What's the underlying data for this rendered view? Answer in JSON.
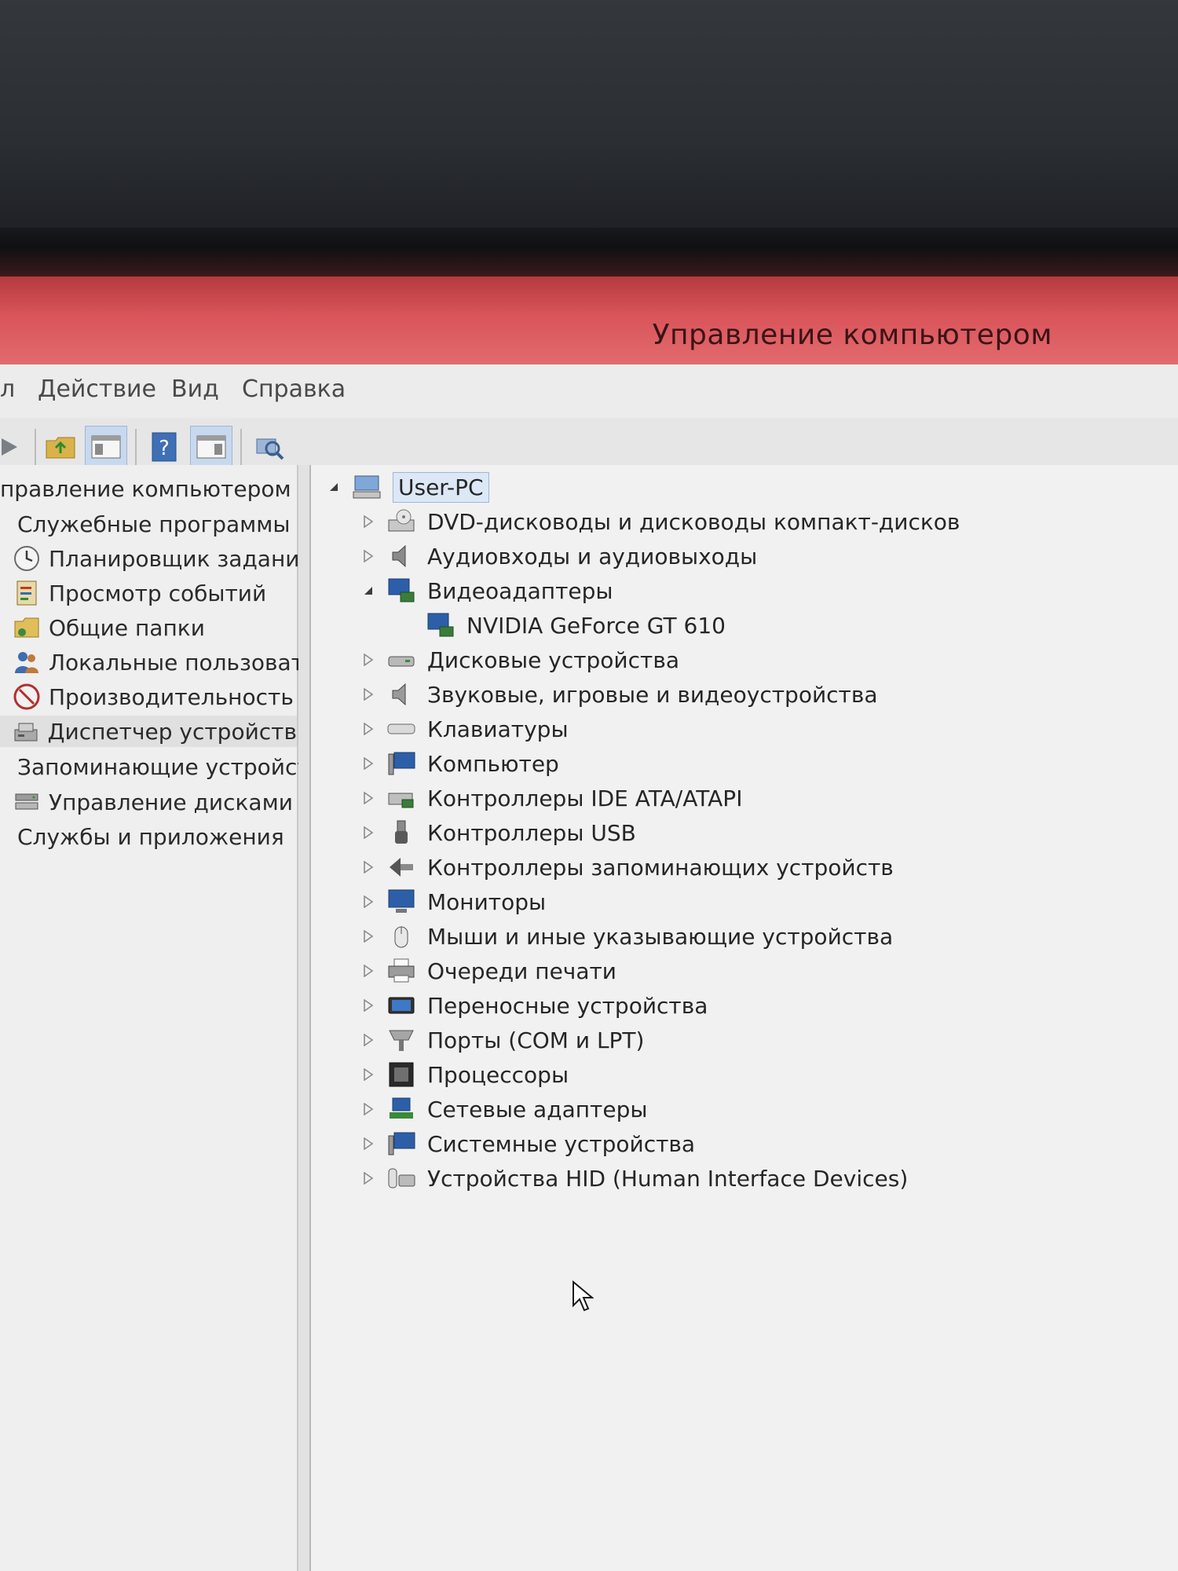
{
  "window": {
    "title": "Управление компьютером"
  },
  "menu": {
    "file_fragment": "л",
    "items": [
      "Действие",
      "Вид",
      "Справка"
    ]
  },
  "toolbar": {
    "buttons": [
      "forward-icon",
      "up-folder-icon",
      "console-tree-icon",
      "help-icon",
      "action-pane-icon",
      "scan-hardware-icon"
    ]
  },
  "nav": {
    "root": "правление компьютером (л",
    "items": [
      {
        "label": "Служебные программы",
        "level": 0,
        "icon": "tools-icon"
      },
      {
        "label": "Планировщик задани",
        "level": 1,
        "icon": "clock-icon"
      },
      {
        "label": "Просмотр событий",
        "level": 1,
        "icon": "event-viewer-icon"
      },
      {
        "label": "Общие папки",
        "level": 1,
        "icon": "shared-folders-icon"
      },
      {
        "label": "Локальные пользоват",
        "level": 1,
        "icon": "users-icon"
      },
      {
        "label": "Производительность",
        "level": 1,
        "icon": "performance-icon"
      },
      {
        "label": "Диспетчер устройств",
        "level": 1,
        "icon": "device-manager-icon",
        "selected": true
      },
      {
        "label": "Запоминающие устройст",
        "level": 0,
        "icon": "storage-icon"
      },
      {
        "label": "Управление дисками",
        "level": 1,
        "icon": "disk-management-icon"
      },
      {
        "label": "Службы и приложения",
        "level": 0,
        "icon": "services-icon"
      }
    ]
  },
  "device_tree": {
    "root": "User-PC",
    "categories": [
      {
        "label": "DVD-дисководы и дисководы компакт-дисков",
        "expanded": false,
        "icon": "dvd-drive-icon"
      },
      {
        "label": "Аудиовходы и аудиовыходы",
        "expanded": false,
        "icon": "speaker-icon"
      },
      {
        "label": "Видеоадаптеры",
        "expanded": true,
        "icon": "display-adapter-icon",
        "children": [
          "NVIDIA GeForce GT 610"
        ]
      },
      {
        "label": "Дисковые устройства",
        "expanded": false,
        "icon": "disk-drive-icon"
      },
      {
        "label": "Звуковые, игровые и видеоустройства",
        "expanded": false,
        "icon": "sound-icon"
      },
      {
        "label": "Клавиатуры",
        "expanded": false,
        "icon": "keyboard-icon"
      },
      {
        "label": "Компьютер",
        "expanded": false,
        "icon": "computer-icon"
      },
      {
        "label": "Контроллеры IDE ATA/ATAPI",
        "expanded": false,
        "icon": "ide-controller-icon"
      },
      {
        "label": "Контроллеры USB",
        "expanded": false,
        "icon": "usb-icon"
      },
      {
        "label": "Контроллеры запоминающих устройств",
        "expanded": false,
        "icon": "storage-controller-icon"
      },
      {
        "label": "Мониторы",
        "expanded": false,
        "icon": "monitor-icon"
      },
      {
        "label": "Мыши и иные указывающие устройства",
        "expanded": false,
        "icon": "mouse-icon"
      },
      {
        "label": "Очереди печати",
        "expanded": false,
        "icon": "printer-icon"
      },
      {
        "label": "Переносные устройства",
        "expanded": false,
        "icon": "portable-device-icon"
      },
      {
        "label": "Порты (COM и LPT)",
        "expanded": false,
        "icon": "port-icon"
      },
      {
        "label": "Процессоры",
        "expanded": false,
        "icon": "processor-icon"
      },
      {
        "label": "Сетевые адаптеры",
        "expanded": false,
        "icon": "network-adapter-icon"
      },
      {
        "label": "Системные устройства",
        "expanded": false,
        "icon": "system-device-icon"
      },
      {
        "label": "Устройства HID (Human Interface Devices)",
        "expanded": false,
        "icon": "hid-icon"
      }
    ]
  },
  "colors": {
    "titlebar": "#d9555a",
    "selection": "#dce8f6",
    "bezel": "#1f2226"
  }
}
